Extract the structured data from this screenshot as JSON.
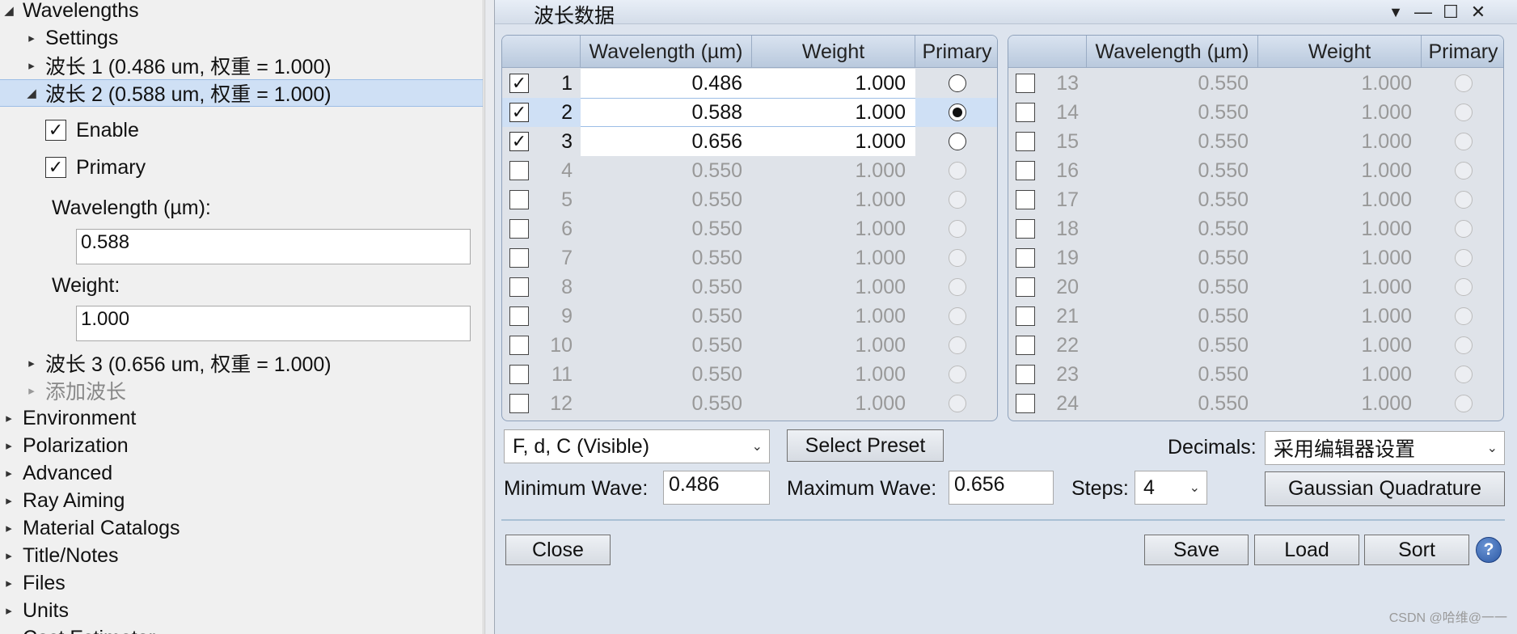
{
  "tree": {
    "wavelengths_label": "Wavelengths",
    "settings_label": "Settings",
    "wave1_label": "波长 1 (0.486 um, 权重 = 1.000)",
    "wave2_label": "波长 2 (0.588 um, 权重 = 1.000)",
    "wave3_label": "波长 3 (0.656 um, 权重 = 1.000)",
    "add_wave_label": "添加波长",
    "enable_label": "Enable",
    "primary_label": "Primary",
    "wavelength_field_label": "Wavelength (µm):",
    "wavelength_value": "0.588",
    "weight_field_label": "Weight:",
    "weight_value": "1.000",
    "sections": [
      "Environment",
      "Polarization",
      "Advanced",
      "Ray Aiming",
      "Material Catalogs",
      "Title/Notes",
      "Files",
      "Units",
      "Cost Estimator"
    ]
  },
  "dialog": {
    "title": "波长数据",
    "columns": {
      "wavelength": "Wavelength (µm)",
      "weight": "Weight",
      "primary": "Primary"
    },
    "rows": [
      {
        "n": "1",
        "wl": "0.486",
        "wt": "1.000",
        "checked": true,
        "primary": false
      },
      {
        "n": "2",
        "wl": "0.588",
        "wt": "1.000",
        "checked": true,
        "primary": true
      },
      {
        "n": "3",
        "wl": "0.656",
        "wt": "1.000",
        "checked": true,
        "primary": false
      },
      {
        "n": "4",
        "wl": "0.550",
        "wt": "1.000",
        "checked": false,
        "primary": false
      },
      {
        "n": "5",
        "wl": "0.550",
        "wt": "1.000",
        "checked": false,
        "primary": false
      },
      {
        "n": "6",
        "wl": "0.550",
        "wt": "1.000",
        "checked": false,
        "primary": false
      },
      {
        "n": "7",
        "wl": "0.550",
        "wt": "1.000",
        "checked": false,
        "primary": false
      },
      {
        "n": "8",
        "wl": "0.550",
        "wt": "1.000",
        "checked": false,
        "primary": false
      },
      {
        "n": "9",
        "wl": "0.550",
        "wt": "1.000",
        "checked": false,
        "primary": false
      },
      {
        "n": "10",
        "wl": "0.550",
        "wt": "1.000",
        "checked": false,
        "primary": false
      },
      {
        "n": "11",
        "wl": "0.550",
        "wt": "1.000",
        "checked": false,
        "primary": false
      },
      {
        "n": "12",
        "wl": "0.550",
        "wt": "1.000",
        "checked": false,
        "primary": false
      },
      {
        "n": "13",
        "wl": "0.550",
        "wt": "1.000",
        "checked": false,
        "primary": false
      },
      {
        "n": "14",
        "wl": "0.550",
        "wt": "1.000",
        "checked": false,
        "primary": false
      },
      {
        "n": "15",
        "wl": "0.550",
        "wt": "1.000",
        "checked": false,
        "primary": false
      },
      {
        "n": "16",
        "wl": "0.550",
        "wt": "1.000",
        "checked": false,
        "primary": false
      },
      {
        "n": "17",
        "wl": "0.550",
        "wt": "1.000",
        "checked": false,
        "primary": false
      },
      {
        "n": "18",
        "wl": "0.550",
        "wt": "1.000",
        "checked": false,
        "primary": false
      },
      {
        "n": "19",
        "wl": "0.550",
        "wt": "1.000",
        "checked": false,
        "primary": false
      },
      {
        "n": "20",
        "wl": "0.550",
        "wt": "1.000",
        "checked": false,
        "primary": false
      },
      {
        "n": "21",
        "wl": "0.550",
        "wt": "1.000",
        "checked": false,
        "primary": false
      },
      {
        "n": "22",
        "wl": "0.550",
        "wt": "1.000",
        "checked": false,
        "primary": false
      },
      {
        "n": "23",
        "wl": "0.550",
        "wt": "1.000",
        "checked": false,
        "primary": false
      },
      {
        "n": "24",
        "wl": "0.550",
        "wt": "1.000",
        "checked": false,
        "primary": false
      }
    ],
    "preset_value": "F, d, C (Visible)",
    "select_preset": "Select Preset",
    "decimals_label": "Decimals:",
    "decimals_value": "采用编辑器设置",
    "min_wave_label": "Minimum Wave:",
    "min_wave_value": "0.486",
    "max_wave_label": "Maximum Wave:",
    "max_wave_value": "0.656",
    "steps_label": "Steps:",
    "steps_value": "4",
    "gaussian": "Gaussian Quadrature",
    "close": "Close",
    "save": "Save",
    "load": "Load",
    "sort": "Sort",
    "help": "?"
  },
  "watermark": "CSDN @哈维@一一",
  "icons": {
    "expanded": "triangle-down-icon",
    "collapsed": "triangle-right-icon",
    "check": "checkmark-icon",
    "dropdown": "chevron-down-icon",
    "minimize": "minimize-icon",
    "maximize": "maximize-icon",
    "close": "close-icon",
    "menu": "menu-arrow-icon",
    "help": "help-icon"
  }
}
